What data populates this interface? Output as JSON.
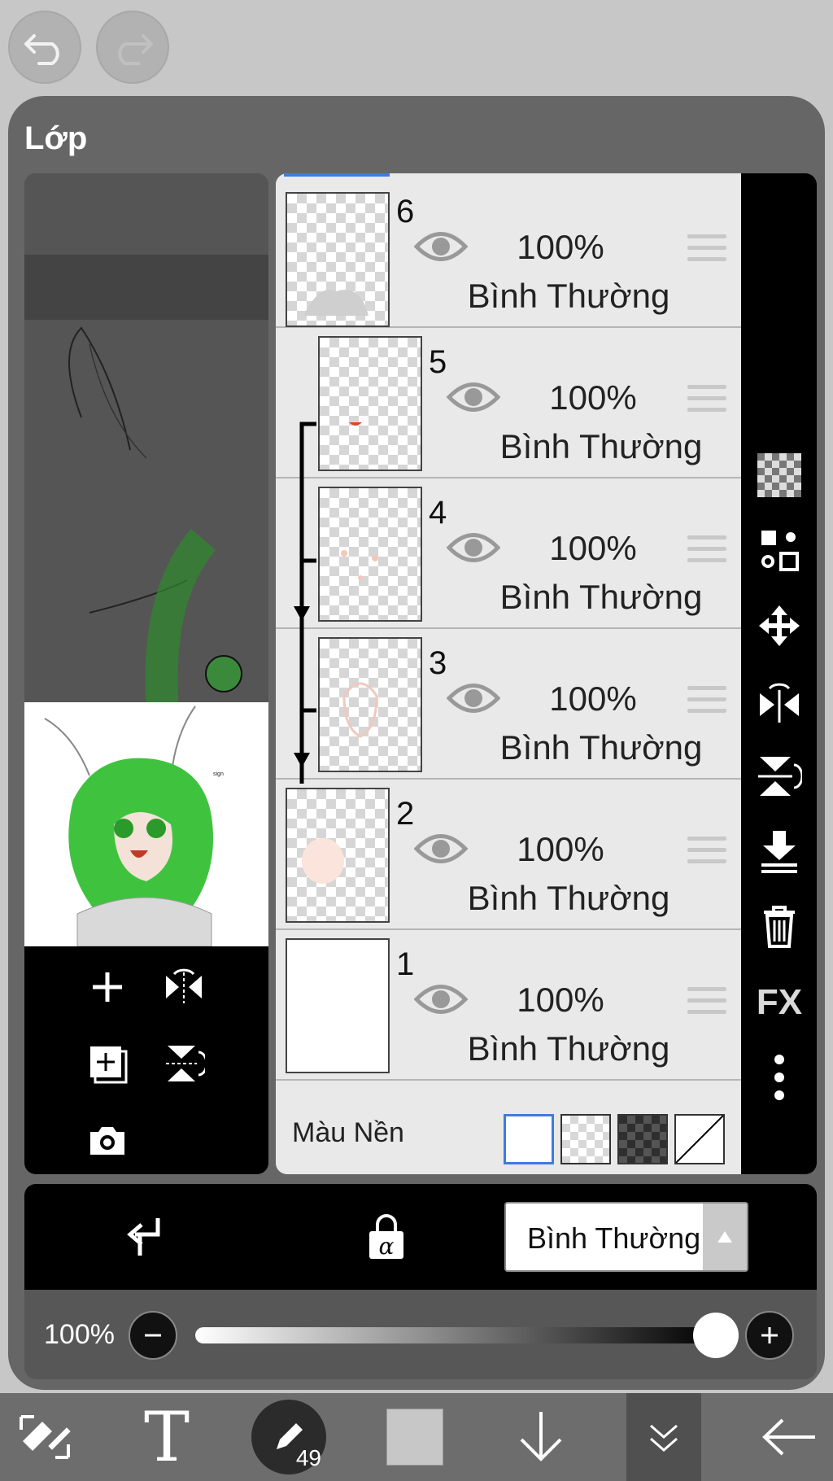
{
  "header": {
    "undo_icon": "undo-icon",
    "redo_icon": "redo-icon"
  },
  "panel": {
    "title": "Lớp"
  },
  "layers": [
    {
      "number": "6",
      "opacity": "100%",
      "mode": "Bình Thường",
      "visible": true,
      "clipped": false
    },
    {
      "number": "5",
      "opacity": "100%",
      "mode": "Bình Thường",
      "visible": true,
      "clipped": true
    },
    {
      "number": "4",
      "opacity": "100%",
      "mode": "Bình Thường",
      "visible": true,
      "clipped": true
    },
    {
      "number": "3",
      "opacity": "100%",
      "mode": "Bình Thường",
      "visible": true,
      "clipped": true
    },
    {
      "number": "2",
      "opacity": "100%",
      "mode": "Bình Thường",
      "visible": true,
      "clipped": false
    },
    {
      "number": "1",
      "opacity": "100%",
      "mode": "Bình Thường",
      "visible": true,
      "clipped": false
    }
  ],
  "background": {
    "label": "Màu Nền",
    "options": [
      "white",
      "checker-light",
      "checker-dark",
      "none"
    ],
    "selected": "white"
  },
  "side_tools": [
    "checker-icon",
    "swap-layer-icon",
    "move-icon",
    "flip-horizontal-icon",
    "flip-vertical-icon",
    "merge-down-icon",
    "trash-icon",
    "fx-icon",
    "more-icon"
  ],
  "side_fx_label": "FX",
  "preview_tools": [
    "add-layer-icon",
    "flip-horizontal-icon",
    "add-layer-copy-icon",
    "flip-vertical-icon",
    "camera-icon"
  ],
  "blend": {
    "clip_icon": "clip-icon",
    "alpha_lock_icon": "alpha-lock-icon",
    "mode": "Bình Thường"
  },
  "opacity": {
    "label": "100%",
    "value": 1.0
  },
  "toolbar": {
    "brush_size": "49",
    "text_glyph": "T",
    "items": [
      "transform-icon",
      "text-icon",
      "brush-icon",
      "color-swatch",
      "down-arrow-icon",
      "layers-collapse-icon",
      "back-arrow-icon"
    ]
  },
  "colors": {
    "panel": "#666666",
    "accent": "#3f7be0",
    "hair_green": "#3fc33f"
  }
}
